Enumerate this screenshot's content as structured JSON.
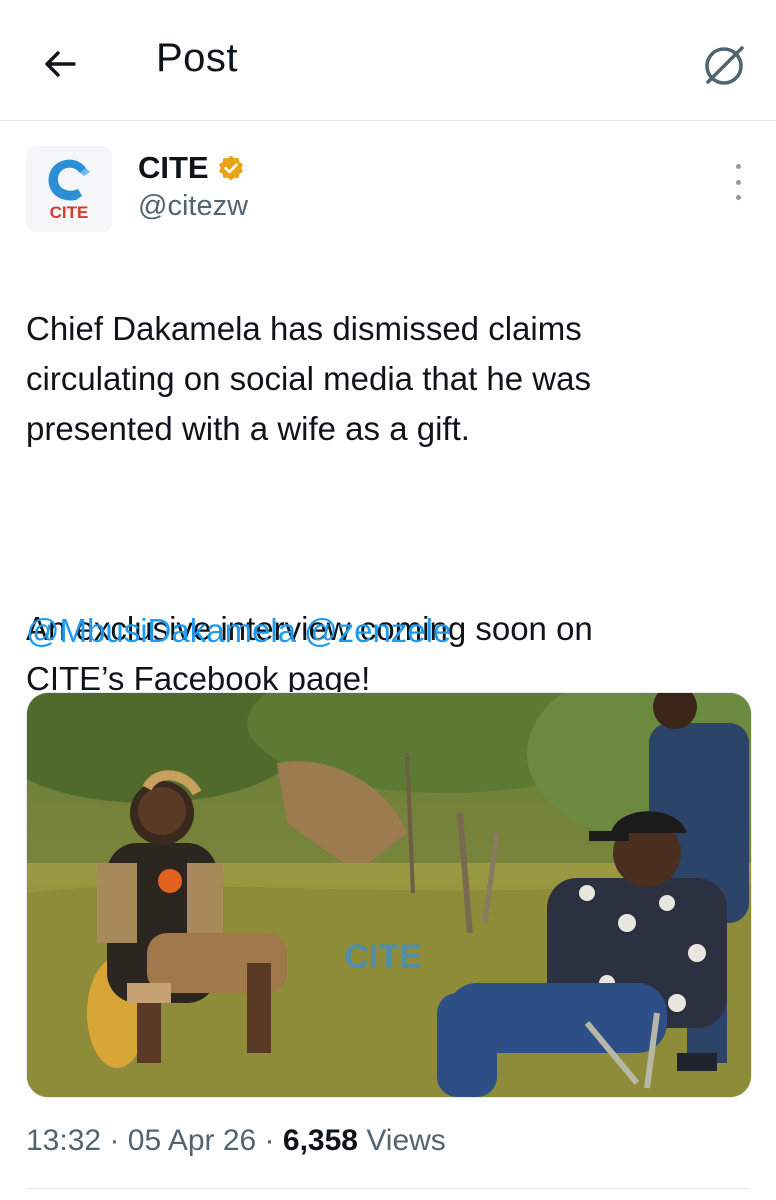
{
  "header": {
    "title": "Post",
    "back_icon": "arrow-left-icon",
    "grok_icon": "grok-icon"
  },
  "post": {
    "author": {
      "name": "CITE",
      "handle": "@citezw",
      "avatar_text": "CITE",
      "verified_color": "#e8a317"
    },
    "paragraph_1": "Chief Dakamela has dismissed claims\ncirculating on social media that he was\npresented with a wife as a gift.",
    "paragraph_2": "An exclusive interview coming soon on\nCITE’s Facebook page!",
    "mentions": [
      "@MbusiDakamela",
      "@zenzele"
    ],
    "media": {
      "watermark": "CITE"
    },
    "time": "13:32",
    "date": "05 Apr 26",
    "views_count": "6,358",
    "views_label": "Views",
    "separator": "·"
  },
  "colors": {
    "link": "#1d9bf0",
    "secondary_text": "#536471",
    "primary_text": "#0f1419"
  }
}
